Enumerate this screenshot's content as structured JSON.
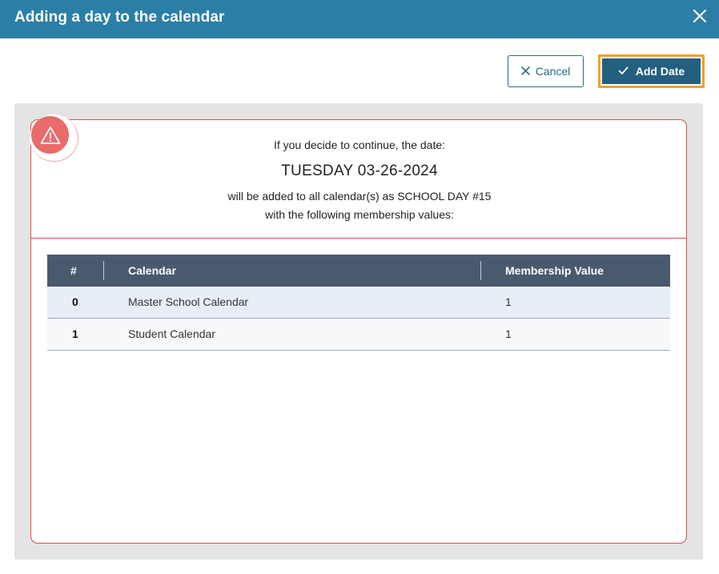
{
  "dialog": {
    "title": "Adding a day to the calendar",
    "close_icon": "close-icon"
  },
  "actions": {
    "cancel_label": "Cancel",
    "cancel_icon": "x-icon",
    "add_label": "Add Date",
    "add_icon": "check-icon"
  },
  "message": {
    "line1": "If you decide to continue, the date:",
    "date": "TUESDAY 03-26-2024",
    "line3": "will be added to all calendar(s) as SCHOOL DAY #15",
    "line4": "with the following membership values:"
  },
  "table": {
    "headers": [
      "#",
      "Calendar",
      "Membership Value"
    ],
    "rows": [
      {
        "num": "0",
        "calendar": "Master School Calendar",
        "value": "1"
      },
      {
        "num": "1",
        "calendar": "Student Calendar",
        "value": "1"
      }
    ]
  },
  "colors": {
    "titlebar": "#2b7fa6",
    "primary_button": "#245f7f",
    "focus_outline": "#f0a124",
    "warning": "#e96b6b",
    "table_header": "#4a5a6e"
  }
}
